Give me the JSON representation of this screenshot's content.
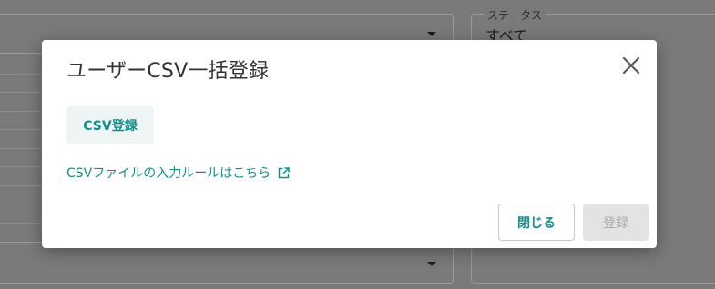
{
  "background": {
    "status_filter": {
      "legend": "ステータス",
      "value": "すべて"
    }
  },
  "dialog": {
    "title": "ユーザーCSV一括登録",
    "close_icon": "close-icon",
    "csv_register_label": "CSV登録",
    "rule_link_label": "CSVファイルの入力ルールはこちら",
    "external_link_icon": "external-link-icon",
    "close_button_label": "閉じる",
    "submit_button_label": "登録",
    "submit_disabled": true
  },
  "colors": {
    "accent": "#13908a",
    "overlay": "#7a7a7a",
    "dialog_bg": "#ffffff",
    "title_text": "#333333",
    "disabled_bg": "#e3e3e3",
    "disabled_text": "#a8a8a8"
  }
}
